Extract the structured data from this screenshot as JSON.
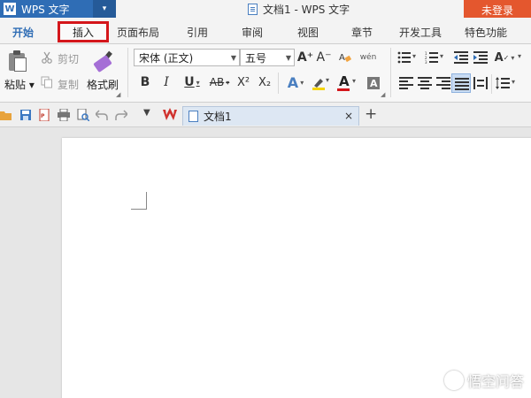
{
  "app": {
    "name": "WPS 文字",
    "logo_text": "W",
    "menu_arrow": "▾",
    "doc_title": "文档1 - WPS 文字",
    "login_label": "未登录"
  },
  "tabs": [
    {
      "label": "开始",
      "active": true
    },
    {
      "label": "插入",
      "highlighted": true
    },
    {
      "label": "页面布局"
    },
    {
      "label": "引用"
    },
    {
      "label": "审阅"
    },
    {
      "label": "视图"
    },
    {
      "label": "章节"
    },
    {
      "label": "开发工具"
    },
    {
      "label": "特色功能"
    }
  ],
  "clipboard": {
    "paste_label": "粘贴",
    "cut_label": "剪切",
    "copy_label": "复制",
    "format_painter_label": "格式刷"
  },
  "font": {
    "font_name": "宋体 (正文)",
    "font_size": "五号",
    "bold": "B",
    "italic": "I",
    "underline": "U",
    "strikethrough": "AB",
    "superscript": "X²",
    "subscript": "X₂",
    "grow": "A⁺",
    "shrink": "A⁻",
    "font_color_letter": "A",
    "text_effect_letter": "A",
    "pinyin_label": "wén"
  },
  "colors": {
    "app_menu": "#2f6db5",
    "login": "#e4572e",
    "highlight_border": "#d4161b",
    "font_color_bar": "#d4161b",
    "highlighter_bar": "#f5d400"
  },
  "document_tab": {
    "name": "文档1",
    "close": "×",
    "add": "+"
  },
  "watermark": {
    "text": "悟空问答"
  }
}
